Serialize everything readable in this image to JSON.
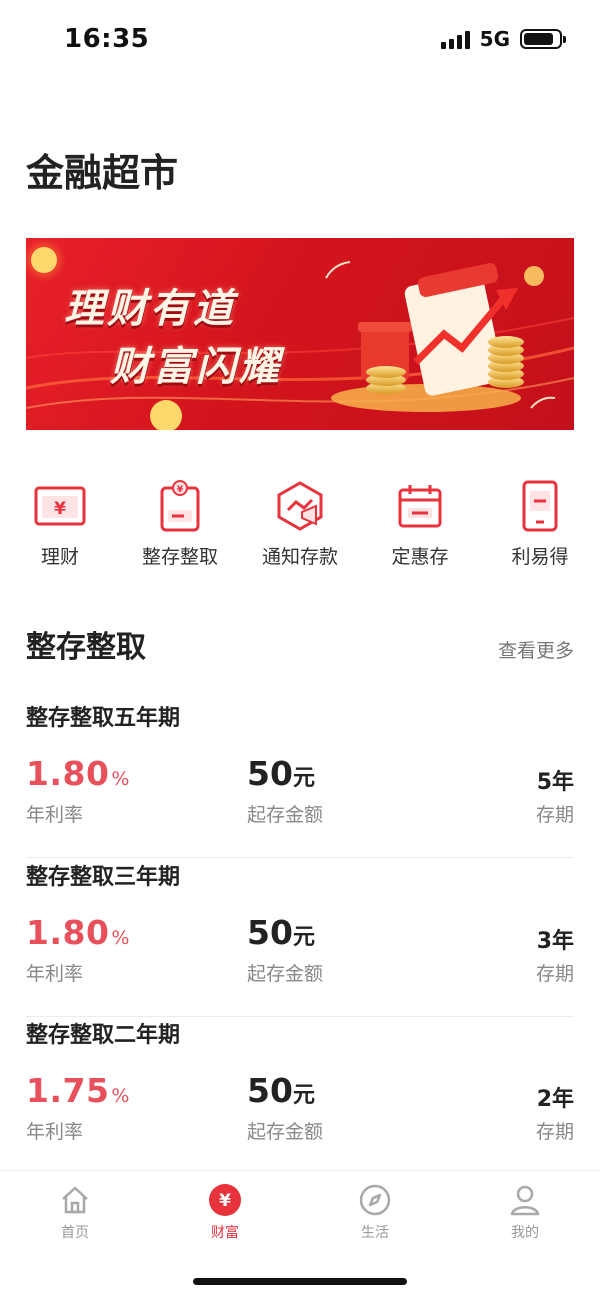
{
  "status": {
    "time": "16:35",
    "network": "5G",
    "battery_level": 0.85
  },
  "page": {
    "title": "金融超市"
  },
  "banner": {
    "line1": "理财有道",
    "line2": "财富闪耀"
  },
  "quick_entries": [
    {
      "label": "理财",
      "icon": "wallet-yuan-icon"
    },
    {
      "label": "整存整取",
      "icon": "document-yuan-icon"
    },
    {
      "label": "通知存款",
      "icon": "megaphone-icon"
    },
    {
      "label": "定惠存",
      "icon": "calendar-icon"
    },
    {
      "label": "利易得",
      "icon": "phone-icon"
    }
  ],
  "section": {
    "title": "整存整取",
    "more": "查看更多"
  },
  "products": [
    {
      "name": "整存整取五年期",
      "rate": "1.80",
      "rate_unit": "%",
      "rate_label": "年利率",
      "amount": "50",
      "amount_unit": "元",
      "amount_label": "起存金额",
      "term": "5年",
      "term_label": "存期"
    },
    {
      "name": "整存整取三年期",
      "rate": "1.80",
      "rate_unit": "%",
      "rate_label": "年利率",
      "amount": "50",
      "amount_unit": "元",
      "amount_label": "起存金额",
      "term": "3年",
      "term_label": "存期"
    },
    {
      "name": "整存整取二年期",
      "rate": "1.75",
      "rate_unit": "%",
      "rate_label": "年利率",
      "amount": "50",
      "amount_unit": "元",
      "amount_label": "起存金额",
      "term": "2年",
      "term_label": "存期"
    }
  ],
  "tabbar": {
    "tabs": [
      {
        "label": "首页",
        "icon": "home-icon",
        "active": false
      },
      {
        "label": "财富",
        "icon": "yuan-circle-icon",
        "active": true
      },
      {
        "label": "生活",
        "icon": "compass-icon",
        "active": false
      },
      {
        "label": "我的",
        "icon": "user-icon",
        "active": false
      }
    ]
  },
  "colors": {
    "accent": "#e8323c",
    "rate": "#e8505b",
    "banner": "#d3141c"
  }
}
